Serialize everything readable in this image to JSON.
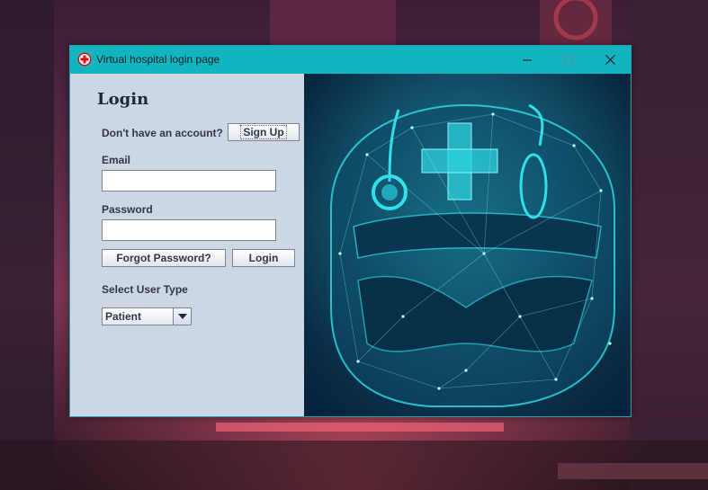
{
  "window": {
    "title": "Virtual hospital login page",
    "title_bar_color": "#12b4c0"
  },
  "icons": {
    "app": "red-cross-icon",
    "minimize": "minimize-icon",
    "maximize": "maximize-icon",
    "close": "close-icon",
    "dropdown": "chevron-down-icon"
  },
  "login_form": {
    "heading": "Login",
    "no_account_text": "Don't have an account?",
    "sign_up_label": "Sign Up",
    "email_label": "Email",
    "email_value": "",
    "password_label": "Password",
    "password_value": "",
    "forgot_password_label": "Forgot Password?",
    "login_label": "Login",
    "user_type_label": "Select User Type",
    "user_type_selected": "Patient"
  },
  "illustration": {
    "subject": "medical-helmet-illustration",
    "accent": "#2fe0ea"
  }
}
